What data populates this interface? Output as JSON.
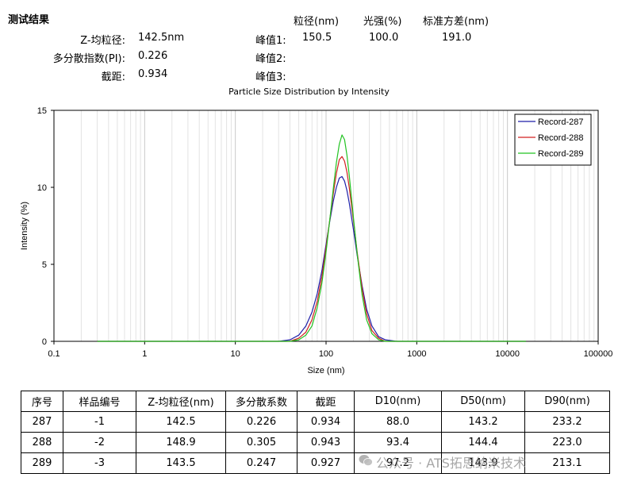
{
  "summary": {
    "title": "测试结果",
    "z_avg_label": "Z-均粒径:",
    "z_avg_value": "142.5nm",
    "pdi_label": "多分散指数(PI):",
    "pdi_value": "0.226",
    "intercept_label": "截距:",
    "intercept_value": "0.934"
  },
  "peaks": {
    "headers": [
      "粒径(nm)",
      "光强(%)",
      "标准方差(nm)"
    ],
    "rows": [
      {
        "label": "峰值1:",
        "size": "150.5",
        "intensity": "100.0",
        "sd": "191.0"
      },
      {
        "label": "峰值2:",
        "size": "",
        "intensity": "",
        "sd": ""
      },
      {
        "label": "峰值3:",
        "size": "",
        "intensity": "",
        "sd": ""
      }
    ]
  },
  "chart_data": {
    "type": "line",
    "title": "Particle Size Distribution by Intensity",
    "xlabel": "Size (nm)",
    "ylabel": "Intensity (%)",
    "xscale": "log",
    "xlim": [
      0.1,
      100000
    ],
    "ylim": [
      0,
      15
    ],
    "x_ticks": [
      "0.1",
      "1",
      "10",
      "100",
      "1000",
      "10000",
      "100000"
    ],
    "y_ticks": [
      "0",
      "5",
      "10",
      "15"
    ],
    "grid": true,
    "legend_position": "top-right",
    "series": [
      {
        "name": "Record-287",
        "color": "#1f1fa8",
        "x": [
          0.3,
          30,
          40,
          50,
          60,
          70,
          80,
          90,
          100,
          110,
          120,
          130,
          140,
          150,
          160,
          170,
          180,
          200,
          220,
          250,
          280,
          320,
          380,
          450,
          600,
          16000
        ],
        "y": [
          0,
          0,
          0.1,
          0.4,
          1.0,
          1.9,
          3.1,
          4.6,
          6.3,
          7.8,
          9.1,
          10.0,
          10.6,
          10.7,
          10.4,
          9.8,
          9.0,
          7.3,
          5.6,
          3.6,
          2.1,
          1.0,
          0.3,
          0.1,
          0,
          0
        ]
      },
      {
        "name": "Record-288",
        "color": "#d22020",
        "x": [
          0.3,
          30,
          40,
          50,
          60,
          70,
          80,
          90,
          100,
          110,
          120,
          130,
          140,
          150,
          160,
          170,
          180,
          200,
          220,
          250,
          280,
          320,
          380,
          450,
          600,
          16000
        ],
        "y": [
          0,
          0,
          0,
          0.2,
          0.6,
          1.4,
          2.6,
          4.2,
          6.1,
          7.9,
          9.6,
          10.9,
          11.8,
          12.0,
          11.7,
          11.0,
          10.0,
          7.9,
          5.8,
          3.4,
          1.8,
          0.7,
          0.2,
          0,
          0,
          0
        ]
      },
      {
        "name": "Record-289",
        "color": "#22c322",
        "x": [
          0.3,
          30,
          40,
          50,
          60,
          70,
          80,
          90,
          100,
          110,
          120,
          130,
          140,
          150,
          160,
          170,
          180,
          200,
          220,
          250,
          280,
          320,
          380,
          450,
          600,
          16000
        ],
        "y": [
          0,
          0,
          0,
          0.1,
          0.4,
          1.0,
          2.2,
          3.8,
          5.8,
          7.9,
          9.9,
          11.6,
          12.8,
          13.4,
          13.1,
          12.1,
          10.8,
          8.1,
          5.7,
          3.0,
          1.4,
          0.5,
          0.1,
          0,
          0,
          0
        ]
      }
    ]
  },
  "table": {
    "headers": [
      "序号",
      "样品编号",
      "Z-均粒径(nm)",
      "多分散系数",
      "截距",
      "D10(nm)",
      "D50(nm)",
      "D90(nm)"
    ],
    "rows": [
      [
        "287",
        "-1",
        "142.5",
        "0.226",
        "0.934",
        "88.0",
        "143.2",
        "233.2"
      ],
      [
        "288",
        "-2",
        "148.9",
        "0.305",
        "0.943",
        "93.4",
        "144.4",
        "223.0"
      ],
      [
        "289",
        "-3",
        "143.5",
        "0.247",
        "0.927",
        "97.2",
        "143.9",
        "213.1"
      ]
    ]
  },
  "watermark": "公众号 · ATS拓思纳米技术"
}
